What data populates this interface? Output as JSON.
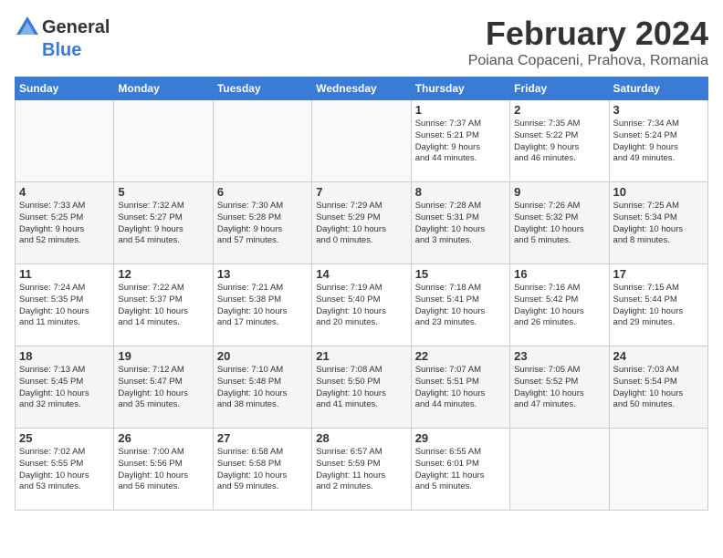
{
  "logo": {
    "general": "General",
    "blue": "Blue"
  },
  "title": "February 2024",
  "subtitle": "Poiana Copaceni, Prahova, Romania",
  "weekdays": [
    "Sunday",
    "Monday",
    "Tuesday",
    "Wednesday",
    "Thursday",
    "Friday",
    "Saturday"
  ],
  "weeks": [
    [
      {
        "day": "",
        "info": ""
      },
      {
        "day": "",
        "info": ""
      },
      {
        "day": "",
        "info": ""
      },
      {
        "day": "",
        "info": ""
      },
      {
        "day": "1",
        "info": "Sunrise: 7:37 AM\nSunset: 5:21 PM\nDaylight: 9 hours\nand 44 minutes."
      },
      {
        "day": "2",
        "info": "Sunrise: 7:35 AM\nSunset: 5:22 PM\nDaylight: 9 hours\nand 46 minutes."
      },
      {
        "day": "3",
        "info": "Sunrise: 7:34 AM\nSunset: 5:24 PM\nDaylight: 9 hours\nand 49 minutes."
      }
    ],
    [
      {
        "day": "4",
        "info": "Sunrise: 7:33 AM\nSunset: 5:25 PM\nDaylight: 9 hours\nand 52 minutes."
      },
      {
        "day": "5",
        "info": "Sunrise: 7:32 AM\nSunset: 5:27 PM\nDaylight: 9 hours\nand 54 minutes."
      },
      {
        "day": "6",
        "info": "Sunrise: 7:30 AM\nSunset: 5:28 PM\nDaylight: 9 hours\nand 57 minutes."
      },
      {
        "day": "7",
        "info": "Sunrise: 7:29 AM\nSunset: 5:29 PM\nDaylight: 10 hours\nand 0 minutes."
      },
      {
        "day": "8",
        "info": "Sunrise: 7:28 AM\nSunset: 5:31 PM\nDaylight: 10 hours\nand 3 minutes."
      },
      {
        "day": "9",
        "info": "Sunrise: 7:26 AM\nSunset: 5:32 PM\nDaylight: 10 hours\nand 5 minutes."
      },
      {
        "day": "10",
        "info": "Sunrise: 7:25 AM\nSunset: 5:34 PM\nDaylight: 10 hours\nand 8 minutes."
      }
    ],
    [
      {
        "day": "11",
        "info": "Sunrise: 7:24 AM\nSunset: 5:35 PM\nDaylight: 10 hours\nand 11 minutes."
      },
      {
        "day": "12",
        "info": "Sunrise: 7:22 AM\nSunset: 5:37 PM\nDaylight: 10 hours\nand 14 minutes."
      },
      {
        "day": "13",
        "info": "Sunrise: 7:21 AM\nSunset: 5:38 PM\nDaylight: 10 hours\nand 17 minutes."
      },
      {
        "day": "14",
        "info": "Sunrise: 7:19 AM\nSunset: 5:40 PM\nDaylight: 10 hours\nand 20 minutes."
      },
      {
        "day": "15",
        "info": "Sunrise: 7:18 AM\nSunset: 5:41 PM\nDaylight: 10 hours\nand 23 minutes."
      },
      {
        "day": "16",
        "info": "Sunrise: 7:16 AM\nSunset: 5:42 PM\nDaylight: 10 hours\nand 26 minutes."
      },
      {
        "day": "17",
        "info": "Sunrise: 7:15 AM\nSunset: 5:44 PM\nDaylight: 10 hours\nand 29 minutes."
      }
    ],
    [
      {
        "day": "18",
        "info": "Sunrise: 7:13 AM\nSunset: 5:45 PM\nDaylight: 10 hours\nand 32 minutes."
      },
      {
        "day": "19",
        "info": "Sunrise: 7:12 AM\nSunset: 5:47 PM\nDaylight: 10 hours\nand 35 minutes."
      },
      {
        "day": "20",
        "info": "Sunrise: 7:10 AM\nSunset: 5:48 PM\nDaylight: 10 hours\nand 38 minutes."
      },
      {
        "day": "21",
        "info": "Sunrise: 7:08 AM\nSunset: 5:50 PM\nDaylight: 10 hours\nand 41 minutes."
      },
      {
        "day": "22",
        "info": "Sunrise: 7:07 AM\nSunset: 5:51 PM\nDaylight: 10 hours\nand 44 minutes."
      },
      {
        "day": "23",
        "info": "Sunrise: 7:05 AM\nSunset: 5:52 PM\nDaylight: 10 hours\nand 47 minutes."
      },
      {
        "day": "24",
        "info": "Sunrise: 7:03 AM\nSunset: 5:54 PM\nDaylight: 10 hours\nand 50 minutes."
      }
    ],
    [
      {
        "day": "25",
        "info": "Sunrise: 7:02 AM\nSunset: 5:55 PM\nDaylight: 10 hours\nand 53 minutes."
      },
      {
        "day": "26",
        "info": "Sunrise: 7:00 AM\nSunset: 5:56 PM\nDaylight: 10 hours\nand 56 minutes."
      },
      {
        "day": "27",
        "info": "Sunrise: 6:58 AM\nSunset: 5:58 PM\nDaylight: 10 hours\nand 59 minutes."
      },
      {
        "day": "28",
        "info": "Sunrise: 6:57 AM\nSunset: 5:59 PM\nDaylight: 11 hours\nand 2 minutes."
      },
      {
        "day": "29",
        "info": "Sunrise: 6:55 AM\nSunset: 6:01 PM\nDaylight: 11 hours\nand 5 minutes."
      },
      {
        "day": "",
        "info": ""
      },
      {
        "day": "",
        "info": ""
      }
    ]
  ]
}
